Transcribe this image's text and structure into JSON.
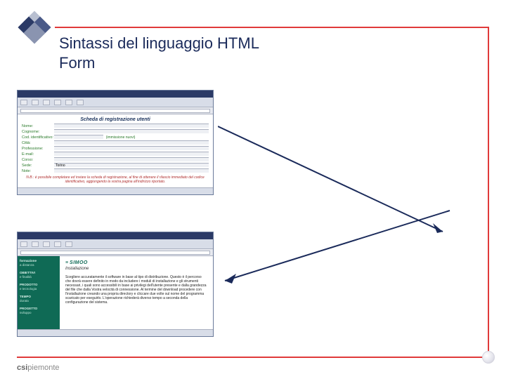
{
  "title_line1": "Sintassi del linguaggio HTML",
  "title_line2": "Form",
  "footer_logo_bold": "csi",
  "footer_logo_rest": "piemonte",
  "form_pane": {
    "heading": "Scheda di registrazione utenti",
    "fields": {
      "nome": "Nome:",
      "cognome": "Cognome:",
      "cod": "Cod. identificativo:",
      "cod_hint": "(immissione nuovi)",
      "citta": "Città:",
      "professione": "Professione:",
      "email": "E-mail:",
      "corso": "Corso:",
      "sede": "Sede:",
      "note": "Note:"
    },
    "sede_value": "Torino",
    "note_text": "N.B.: è possibile completare ed inviare la scheda di registrazione, al fine di ottenere il rilascio immediato del codice identificativo, aggiungendo la vostra pagina all'indirizzo riportato."
  },
  "install_pane": {
    "logo_text": "SIMOO",
    "subtitle": "Installazione",
    "sidebar": {
      "section1_h": "formazione",
      "section1_s": "a distanza",
      "item1_h": "OBIETTIVI",
      "item1_s": "e finalità",
      "item2_h": "PRODOTTO",
      "item2_s": "e tecnologia",
      "item3_h": "TEMPO",
      "item3_s": "durata",
      "item4_h": "PROGETTO",
      "item4_s": "sviluppo"
    },
    "paragraph": "Scegliere accuratamente il software in base al tipo di distribuzione. Questo è il percorso che dovrà essere definito in modo da includere i moduli di installazione e gli strumenti necessari, i quali sono accessibili in base ai privilegi dell'utente presente e dalla grandezza del file che dalla Vostra velocità di connessione. Al termine del download procedere con l'installazione creando una propria directory e cliccare due volte sul nome del programma scaricato per eseguirlo. L'operazione richiederà diverso tempo a seconda della configurazione del sistema."
  }
}
